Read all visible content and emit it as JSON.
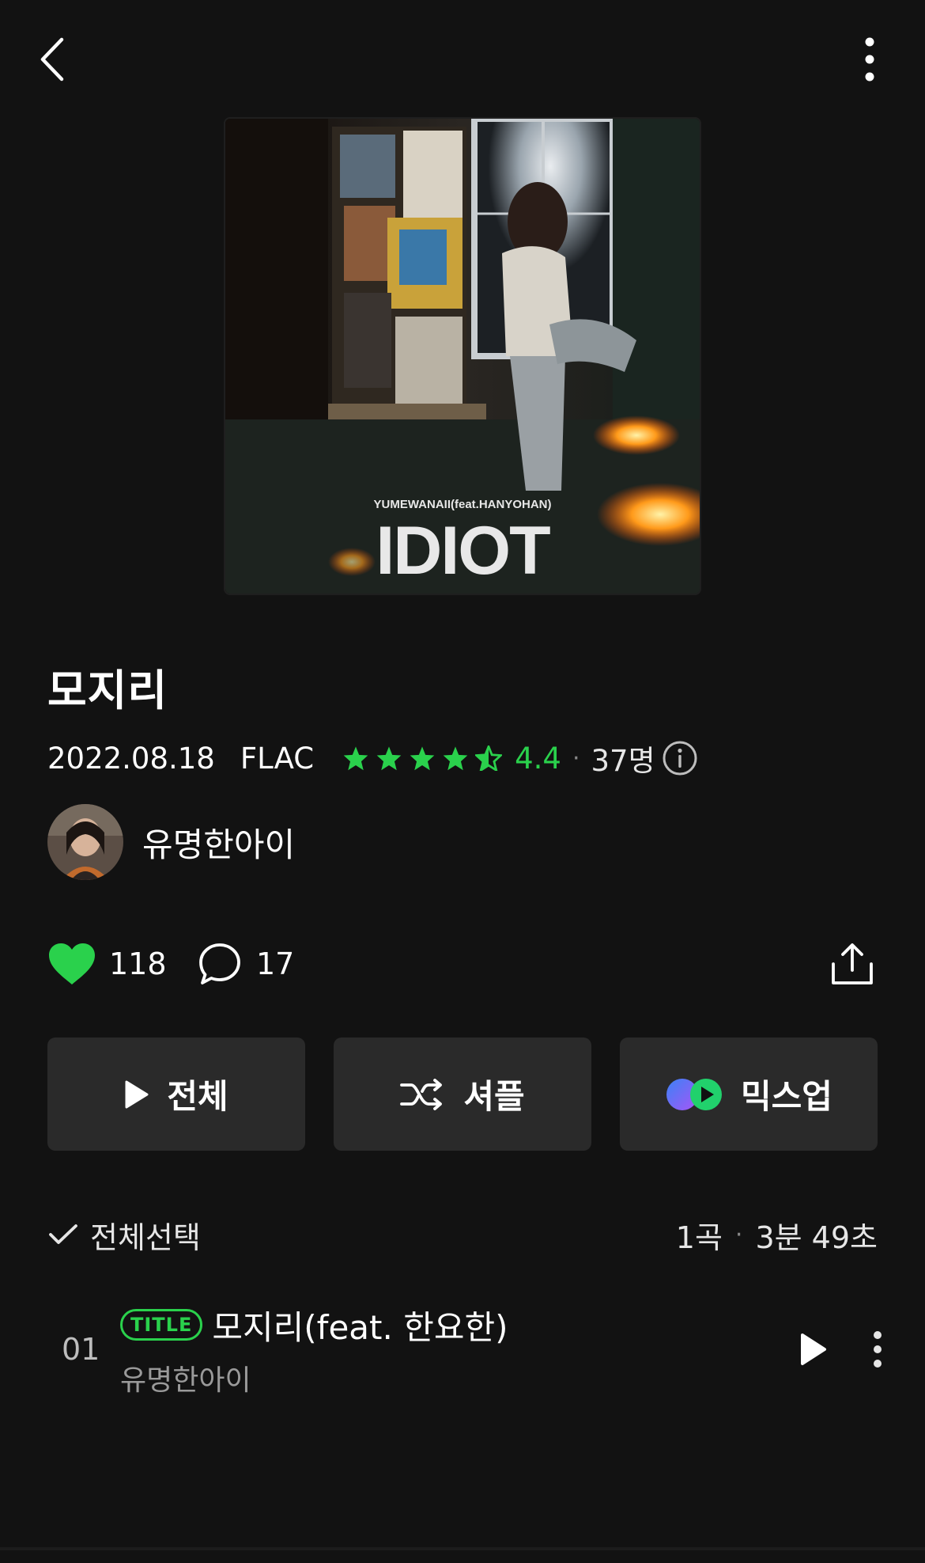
{
  "header": {
    "back_icon": "chevron-left-icon",
    "more_icon": "vertical-dots-icon"
  },
  "album": {
    "cover": {
      "artist_line": "YUMEWANAII(feat.HANYOHAN)",
      "title_text": "IDIOT"
    },
    "title": "모지리",
    "release_date": "2022.08.18",
    "format": "FLAC",
    "rating_stars": 4.5,
    "rating": "4.4",
    "rating_count": "37명",
    "artist": "유명한아이"
  },
  "stats": {
    "likes": "118",
    "comments": "17"
  },
  "buttons": {
    "play_all": "전체",
    "shuffle": "셔플",
    "mixup": "믹스업"
  },
  "list_header": {
    "select_all": "전체선택",
    "track_count": "1곡",
    "duration": "3분 49초"
  },
  "tracks": [
    {
      "number": "01",
      "badge": "TITLE",
      "title": "모지리(feat. 한요한)",
      "artist": "유명한아이"
    }
  ],
  "colors": {
    "background": "#121212",
    "accent_green": "#2ad14c",
    "button_bg": "#2a2a2a"
  }
}
